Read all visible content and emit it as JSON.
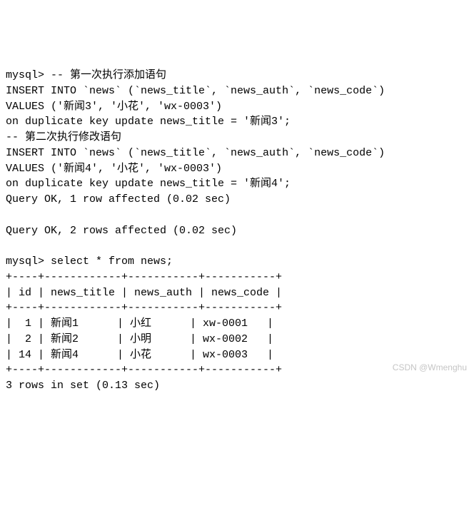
{
  "terminal": {
    "prompt1": "mysql> ",
    "comment1": "-- 第一次执行添加语句",
    "insert1_line1": "INSERT INTO `news` (`news_title`, `news_auth`, `news_code`)",
    "insert1_line2": "VALUES ('新闻3', '小花', 'wx-0003')",
    "insert1_line3": "on duplicate key update news_title = '新闻3';",
    "comment2": "-- 第二次执行修改语句",
    "insert2_line1": "INSERT INTO `news` (`news_title`, `news_auth`, `news_code`)",
    "insert2_line2": "VALUES ('新闻4', '小花', 'wx-0003')",
    "insert2_line3": "on duplicate key update news_title = '新闻4';",
    "result1": "Query OK, 1 row affected (0.02 sec)",
    "result2": "Query OK, 2 rows affected (0.02 sec)",
    "prompt2": "mysql> ",
    "select_stmt": "select * from news;",
    "sep": "+----+------------+-----------+-----------+",
    "header": "| id | news_title | news_auth | news_code |",
    "rows": [
      "|  1 | 新闻1      | 小红      | xw-0001   |",
      "|  2 | 新闻2      | 小明      | wx-0002   |",
      "| 14 | 新闻4      | 小花      | wx-0003   |"
    ],
    "footer": "3 rows in set (0.13 sec)"
  },
  "chart_data": {
    "type": "table",
    "title": "news",
    "columns": [
      "id",
      "news_title",
      "news_auth",
      "news_code"
    ],
    "rows": [
      {
        "id": 1,
        "news_title": "新闻1",
        "news_auth": "小红",
        "news_code": "xw-0001"
      },
      {
        "id": 2,
        "news_title": "新闻2",
        "news_auth": "小明",
        "news_code": "wx-0002"
      },
      {
        "id": 14,
        "news_title": "新闻4",
        "news_auth": "小花",
        "news_code": "wx-0003"
      }
    ]
  },
  "watermark": "CSDN @Wmenghu"
}
